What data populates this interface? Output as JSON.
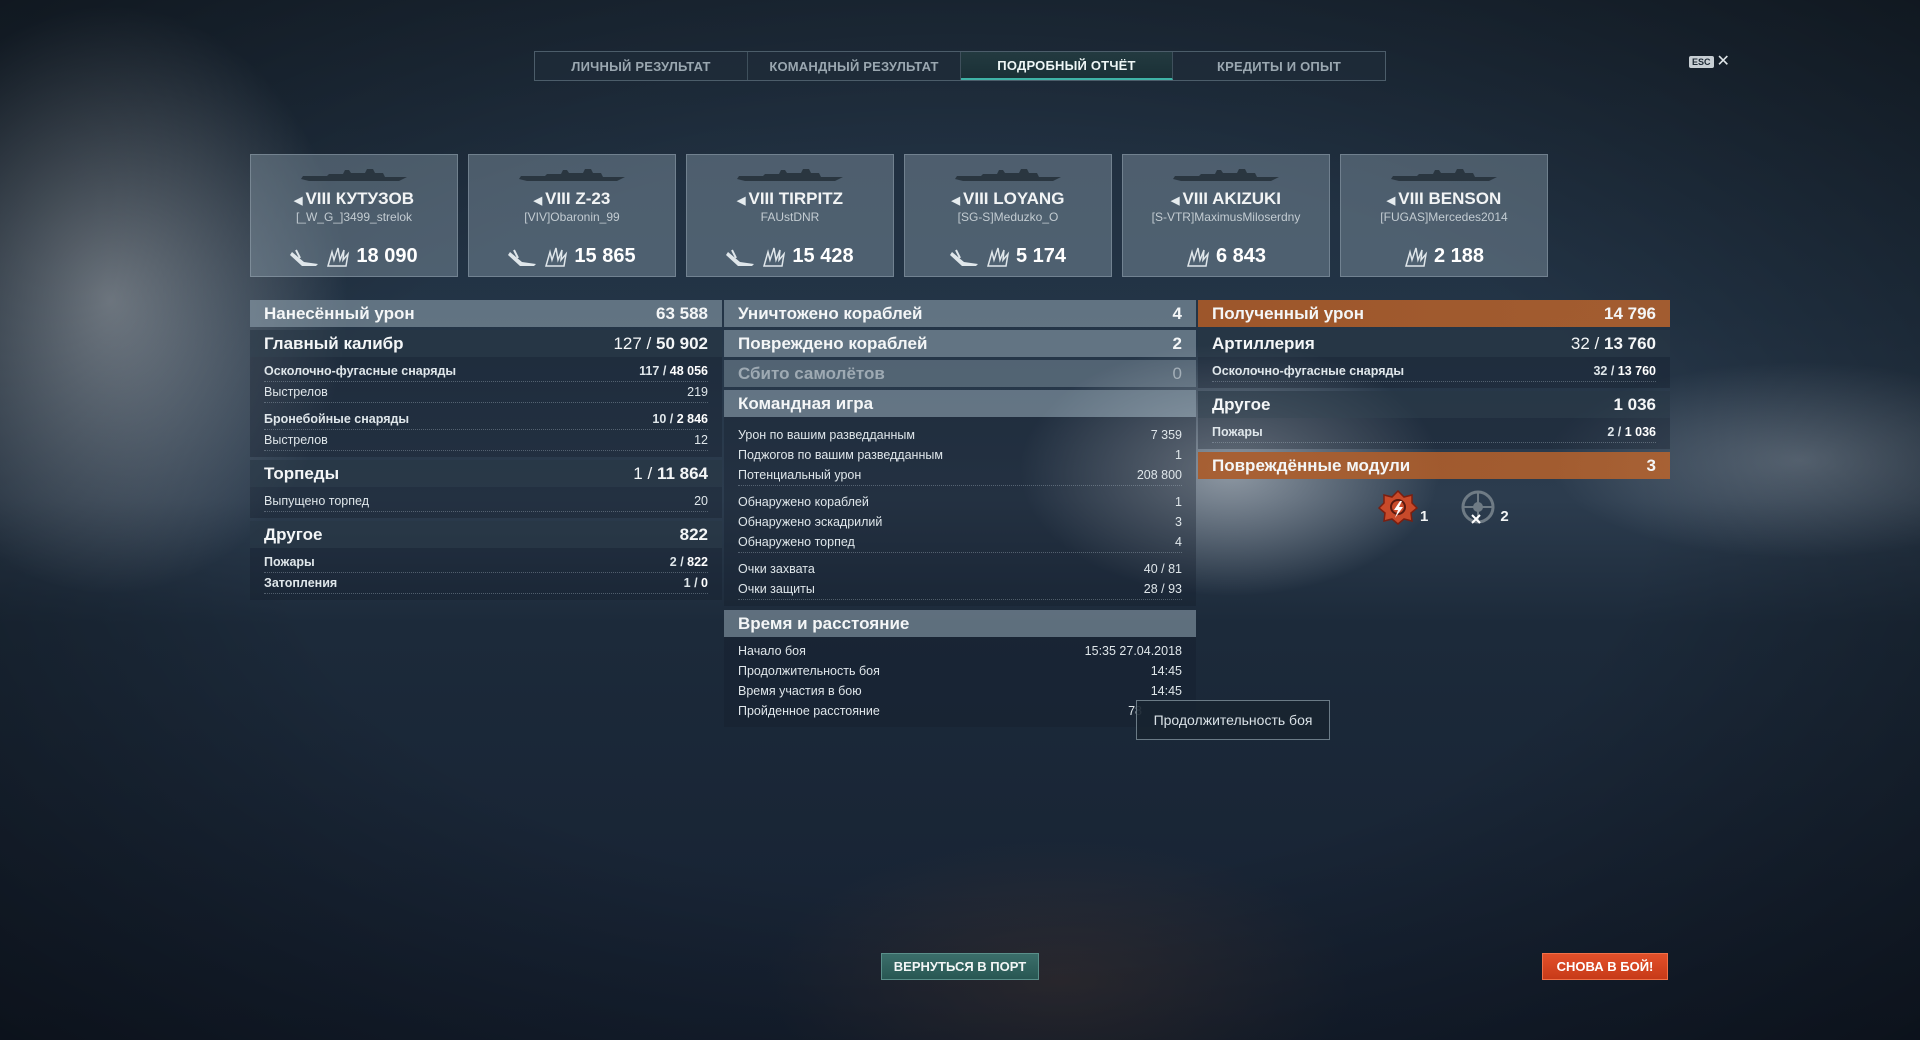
{
  "tabs": [
    {
      "label": "ЛИЧНЫЙ РЕЗУЛЬТАТ",
      "active": false
    },
    {
      "label": "КОМАНДНЫЙ РЕЗУЛЬТАТ",
      "active": false
    },
    {
      "label": "ПОДРОБНЫЙ ОТЧЁТ",
      "active": true
    },
    {
      "label": "КРЕДИТЫ И ОПЫТ",
      "active": false
    }
  ],
  "close": {
    "key": "ESC",
    "icon": "close-icon"
  },
  "ships": [
    {
      "tier": "VIII",
      "name": "КУТУЗОВ",
      "player": "[_W_G_]3499_strelok",
      "damage": "18 090",
      "class_icon": "cruiser-icon",
      "ribbon": true
    },
    {
      "tier": "VIII",
      "name": "Z-23",
      "player": "[VIV]Obaronin_99",
      "damage": "15 865",
      "class_icon": "destroyer-icon",
      "ribbon": true
    },
    {
      "tier": "VIII",
      "name": "TIRPITZ",
      "player": "FAUstDNR",
      "damage": "15 428",
      "class_icon": "battleship-icon",
      "ribbon": true
    },
    {
      "tier": "VIII",
      "name": "LOYANG",
      "player": "[SG-S]Meduzko_O",
      "damage": "5 174",
      "class_icon": "destroyer-icon",
      "ribbon": true
    },
    {
      "tier": "VIII",
      "name": "AKIZUKI",
      "player": "[S-VTR]MaximusMiloserdny",
      "damage": "6 843",
      "class_icon": "destroyer-icon",
      "ribbon": false
    },
    {
      "tier": "VIII",
      "name": "BENSON",
      "player": "[FUGAS]Mercedes2014",
      "damage": "2 188",
      "class_icon": "destroyer-icon",
      "ribbon": false
    }
  ],
  "damage_dealt": {
    "title": "Нанесённый урон",
    "value": "63 588",
    "main_battery": {
      "title": "Главный калибр",
      "hits": "127",
      "dmg": "50 902"
    },
    "he": {
      "label": "Осколочно-фугасные снаряды",
      "hits": "117",
      "dmg": "48 056"
    },
    "he_shots": {
      "label": "Выстрелов",
      "value": "219"
    },
    "ap": {
      "label": "Бронебойные снаряды",
      "hits": "10",
      "dmg": "2 846"
    },
    "ap_shots": {
      "label": "Выстрелов",
      "value": "12"
    },
    "torpedoes": {
      "title": "Торпеды",
      "hits": "1",
      "dmg": "11 864"
    },
    "torps_fired": {
      "label": "Выпущено торпед",
      "value": "20"
    },
    "other": {
      "title": "Другое",
      "value": "822"
    },
    "fires": {
      "label": "Пожары",
      "hits": "2",
      "dmg": "822"
    },
    "floods": {
      "label": "Затопления",
      "hits": "1",
      "dmg": "0"
    }
  },
  "team": {
    "destroyed": {
      "title": "Уничтожено кораблей",
      "value": "4"
    },
    "damaged": {
      "title": "Повреждено кораблей",
      "value": "2"
    },
    "planes": {
      "title": "Сбито самолётов",
      "value": "0"
    },
    "teamplay": {
      "title": "Командная игра"
    },
    "spot_dmg": {
      "label": "Урон по вашим разведданным",
      "value": "7 359"
    },
    "spot_fires": {
      "label": "Поджогов по вашим разведданным",
      "value": "1"
    },
    "potential": {
      "label": "Потенциальный урон",
      "value": "208 800"
    },
    "spotted_ships": {
      "label": "Обнаружено кораблей",
      "value": "1"
    },
    "spotted_squadrons": {
      "label": "Обнаружено эскадрилий",
      "value": "3"
    },
    "spotted_torps": {
      "label": "Обнаружено торпед",
      "value": "4"
    },
    "capture": {
      "label": "Очки захвата",
      "value": "40 / 81"
    },
    "defense": {
      "label": "Очки защиты",
      "value": "28 / 93"
    }
  },
  "time": {
    "title": "Время и расстояние",
    "start": {
      "label": "Начало боя",
      "value": "15:35  27.04.2018"
    },
    "duration": {
      "label": "Продолжительность боя",
      "value": "14:45"
    },
    "participation": {
      "label": "Время участия в бою",
      "value": "14:45"
    },
    "distance": {
      "label": "Пройденное расстояние",
      "value": "78"
    }
  },
  "received": {
    "title": "Полученный урон",
    "value": "14 796",
    "artillery": {
      "title": "Артиллерия",
      "hits": "32",
      "dmg": "13 760"
    },
    "he": {
      "label": "Осколочно-фугасные снаряды",
      "hits": "32",
      "dmg": "13 760"
    },
    "other": {
      "title": "Другое",
      "value": "1 036"
    },
    "fires": {
      "label": "Пожары",
      "hits": "2",
      "dmg": "1 036"
    },
    "modules": {
      "title": "Повреждённые модули",
      "value": "3"
    },
    "module_items": [
      {
        "icon": "engine-damage-icon",
        "count": "1",
        "color": "#d1542f"
      },
      {
        "icon": "rudder-damage-icon",
        "count": "2",
        "color": "#8a96a0"
      }
    ]
  },
  "tooltip": "Продолжительность боя",
  "buttons": {
    "port": "ВЕРНУТЬСЯ В ПОРТ",
    "battle": "СНОВА В БОЙ!"
  }
}
